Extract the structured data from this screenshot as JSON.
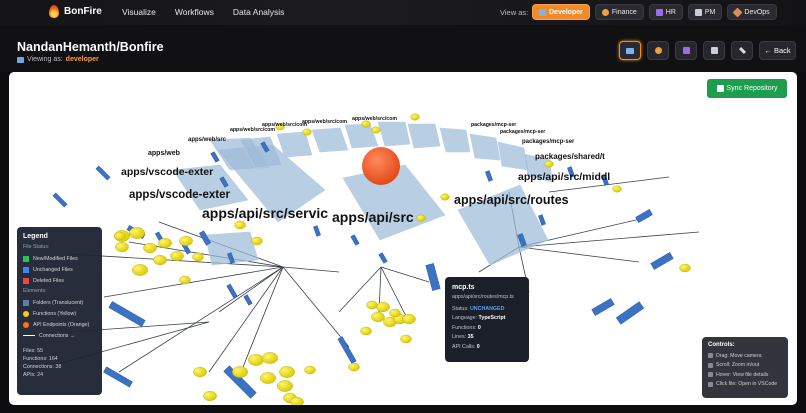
{
  "app": {
    "name": "BonFire",
    "logo_icon": "flame-icon"
  },
  "nav": {
    "items": [
      "Visualize",
      "Workflows",
      "Data Analysis"
    ]
  },
  "view_as": {
    "label": "View as:",
    "roles": [
      {
        "label": "Developer",
        "icon": "laptop-icon",
        "active": true
      },
      {
        "label": "Finance",
        "icon": "money-icon",
        "active": false
      },
      {
        "label": "HR",
        "icon": "people-icon",
        "active": false
      },
      {
        "label": "PM",
        "icon": "chart-icon",
        "active": false
      },
      {
        "label": "DevOps",
        "icon": "rocket-icon",
        "active": false
      }
    ]
  },
  "header": {
    "repo": "NandanHemanth/Bonfire",
    "viewing_label": "Viewing as:",
    "viewing_role": "developer",
    "back_label": "← Back"
  },
  "sync": {
    "label": "Sync Repository"
  },
  "graph": {
    "folder_labels": [
      "apps/web/src/com",
      "apps/web/src/com",
      "apps/web/src/com",
      "apps/web/src/com",
      "apps/web/src",
      "apps/web",
      "apps/vscode-exter",
      "apps/vscode-exter",
      "apps/api/src/servic",
      "apps/api/src",
      "packages/mcp-ser",
      "packages/mcp-ser",
      "packages/mcp-ser",
      "packages/shared/t",
      "apps/api/src/middl",
      "apps/api/src/routes"
    ]
  },
  "legend": {
    "title": "Legend",
    "file_status_title": "File Status:",
    "file_status": [
      {
        "label": "New/Modified Files",
        "color": "#22c55e"
      },
      {
        "label": "Unchanged Files",
        "color": "#3b82f6"
      },
      {
        "label": "Deleted Files",
        "color": "#ef4444"
      }
    ],
    "elements_title": "Elements:",
    "elements": [
      {
        "label": "Folders (Translucent)",
        "color": "#5b7fa8"
      },
      {
        "label": "Functions (Yellow)",
        "color": "#facc15"
      },
      {
        "label": "API Endpoints (Orange)",
        "color": "#f97316"
      }
    ],
    "connections_label": "Connections →",
    "stats": [
      "Files: 55",
      "Functions: 164",
      "Connections: 38",
      "APIs: 24"
    ]
  },
  "tooltip": {
    "name": "mcp.ts",
    "path": "apps/api/src/routes/mcp.ts",
    "status_label": "Status:",
    "status_value": "UNCHANGED",
    "language_label": "Language:",
    "language_value": "TypeScript",
    "functions_label": "Functions:",
    "functions_value": "0",
    "lines_label": "Lines:",
    "lines_value": "35",
    "api_label": "API Calls:",
    "api_value": "0"
  },
  "controls": {
    "title": "Controls:",
    "items": [
      "Drag: Move camera",
      "Scroll: Zoom in/out",
      "Hover: View file details",
      "Click file: Open in VSCode"
    ]
  }
}
